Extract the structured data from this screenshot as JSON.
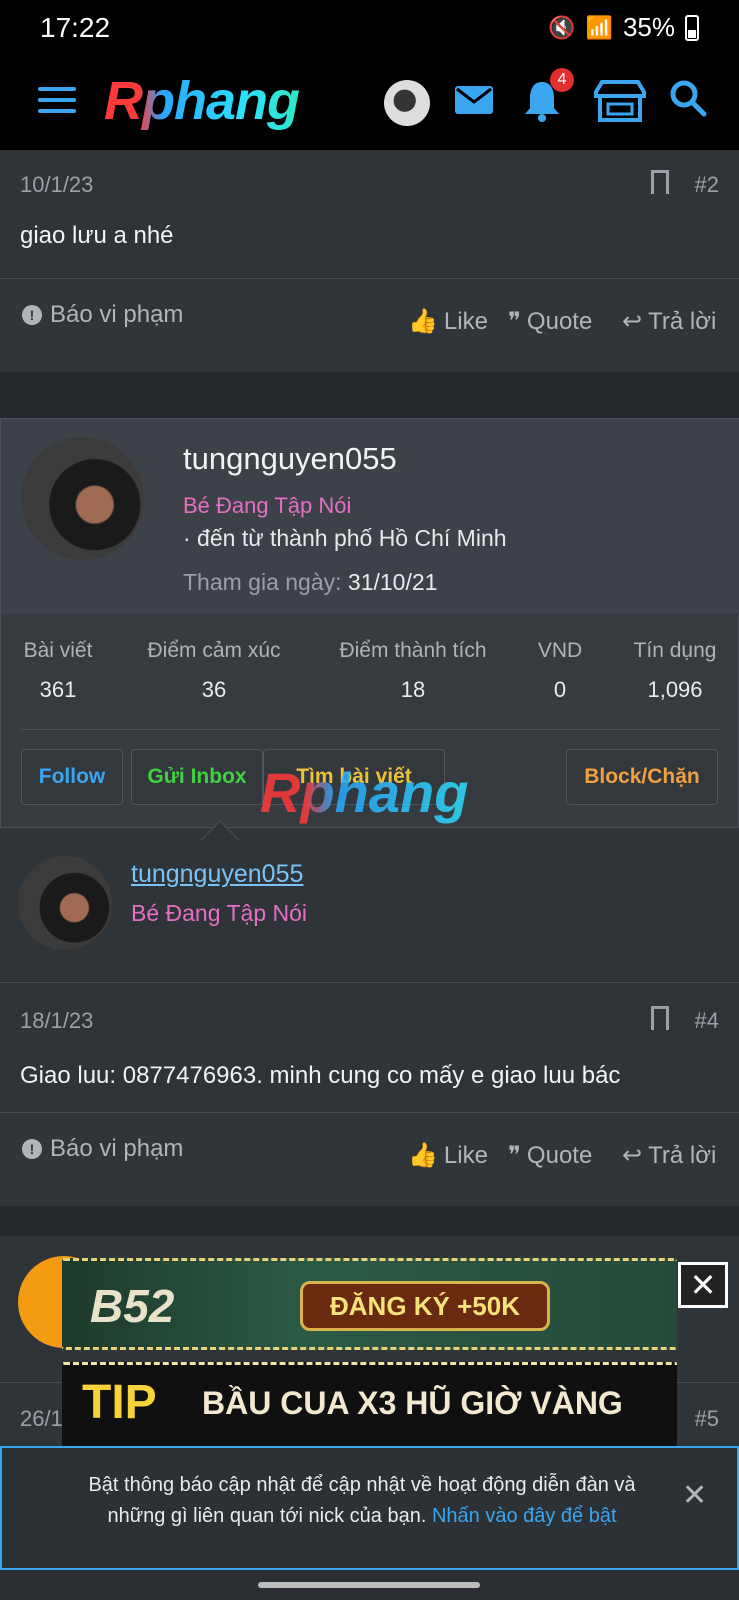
{
  "status_bar": {
    "time": "17:22",
    "battery": "35%"
  },
  "header": {
    "logo": "Rphang",
    "notification_count": "4"
  },
  "posts": [
    {
      "date": "10/1/23",
      "number": "#2",
      "text": "giao lưu a nhé",
      "actions": {
        "report": "Báo vi phạm",
        "like": "Like",
        "quote": "Quote",
        "reply": "Trả lời"
      }
    },
    {
      "date": "18/1/23",
      "number": "#4",
      "text": "Giao luu: 0877476963. minh cung co mấy e giao luu bác",
      "actions": {
        "report": "Báo vi phạm",
        "like": "Like",
        "quote": "Quote",
        "reply": "Trả lời"
      }
    },
    {
      "date": "26/1",
      "number": "#5"
    }
  ],
  "member_popup": {
    "username": "tungnguyen055",
    "user_title": "Bé Đang Tập Nói",
    "location": "· đến từ thành phố Hồ Chí Minh",
    "joined_label": "Tham gia ngày:",
    "joined_value": "31/10/21",
    "stats": [
      {
        "label": "Bài viết",
        "value": "361"
      },
      {
        "label": "Điểm cảm xúc",
        "value": "36"
      },
      {
        "label": "Điểm thành tích",
        "value": "18"
      },
      {
        "label": "VND",
        "value": "0"
      },
      {
        "label": "Tín dụng",
        "value": "1,096"
      }
    ],
    "buttons": {
      "follow": "Follow",
      "inbox": "Gửi Inbox",
      "find_posts": "Tìm bài viết",
      "block": "Block/Chặn"
    },
    "watermark": "Rphang"
  },
  "author": {
    "username": "tungnguyen055",
    "user_title": "Bé Đang Tập Nói"
  },
  "ads": {
    "ad1_brand": "B52",
    "ad1_text": "ĐĂNG KÝ +50K",
    "ad2_brand": "TIP",
    "ad2_text": "BẦU CUA X3 HŨ GIỜ VÀNG",
    "close": "✕"
  },
  "notice": {
    "text": "Bật thông báo cập nhật để cập nhật về hoạt động diễn đàn và những gì liên quan tới nick của bạn.",
    "link": "Nhấn vào đây để bật",
    "close": "✕"
  }
}
